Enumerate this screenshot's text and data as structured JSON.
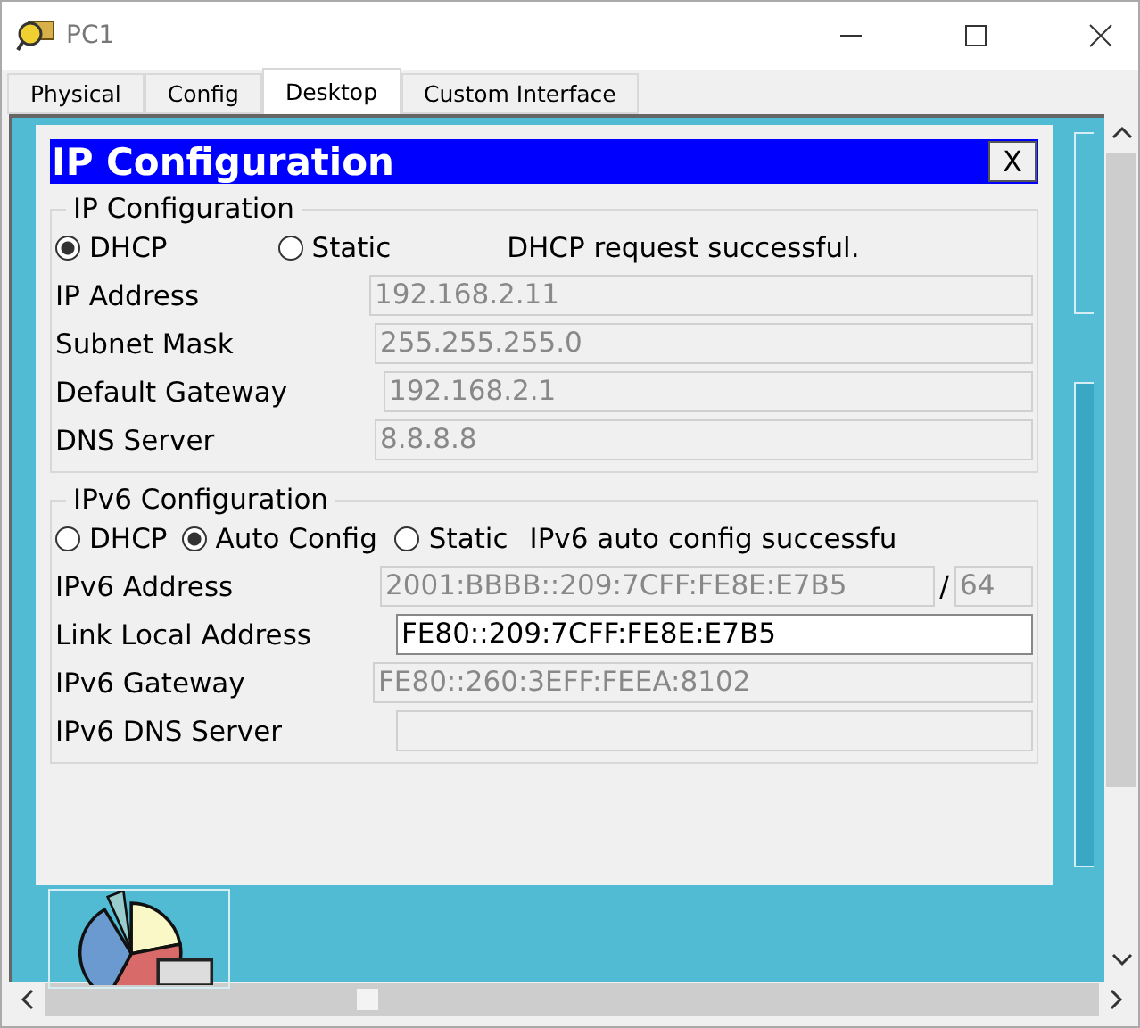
{
  "window": {
    "title": "PC1"
  },
  "tabs": [
    {
      "label": "Physical",
      "selected": false
    },
    {
      "label": "Config",
      "selected": false
    },
    {
      "label": "Desktop",
      "selected": true
    },
    {
      "label": "Custom Interface",
      "selected": false
    }
  ],
  "dialog": {
    "title": "IP Configuration",
    "close": "X",
    "groups": [
      {
        "legend": "IP Configuration",
        "status": "DHCP request successful.",
        "modes": [
          {
            "label": "DHCP",
            "selected": true
          },
          {
            "label": "Static",
            "selected": false
          }
        ],
        "fields": [
          {
            "label": "IP Address",
            "value": "192.168.2.11",
            "disabled": true
          },
          {
            "label": "Subnet Mask",
            "value": "255.255.255.0",
            "disabled": true
          },
          {
            "label": "Default Gateway",
            "value": "192.168.2.1",
            "disabled": true
          },
          {
            "label": "DNS Server",
            "value": "8.8.8.8",
            "disabled": true
          }
        ]
      },
      {
        "legend": "IPv6 Configuration",
        "status": "IPv6 auto config successfu",
        "modes": [
          {
            "label": "DHCP",
            "selected": false
          },
          {
            "label": "Auto Config",
            "selected": true
          },
          {
            "label": "Static",
            "selected": false
          }
        ],
        "fields": [
          {
            "label": "IPv6 Address",
            "value": "2001:BBBB::209:7CFF:FE8E:E7B5",
            "disabled": true,
            "separator": "/",
            "prefix": "64"
          },
          {
            "label": "Link Local Address",
            "value": "FE80::209:7CFF:FE8E:E7B5",
            "disabled": false
          },
          {
            "label": "IPv6 Gateway",
            "value": "FE80::260:3EFF:FEEA:8102",
            "disabled": true
          },
          {
            "label": "IPv6 DNS Server",
            "disabled": true
          }
        ]
      }
    ]
  }
}
